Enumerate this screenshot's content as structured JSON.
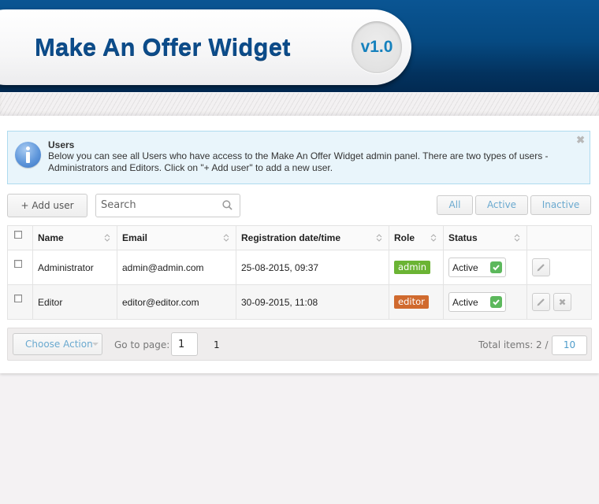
{
  "header": {
    "title": "Make An Offer Widget",
    "version": "v1.0"
  },
  "alert": {
    "icon": "info-icon",
    "title": "Users",
    "text": "Below you can see all Users who have access to the Make An Offer Widget admin panel. There are two types of users - Administrators and Editors. Click on \"+ Add user\" to add a new user.",
    "close_icon": "close-icon"
  },
  "toolbar": {
    "add_user_label": "+ Add user",
    "search_placeholder": "Search",
    "search_value": "",
    "filters": [
      "All",
      "Active",
      "Inactive"
    ]
  },
  "table": {
    "columns": [
      "Name",
      "Email",
      "Registration date/time",
      "Role",
      "Status"
    ],
    "rows": [
      {
        "name": "Administrator",
        "email": "admin@admin.com",
        "registered": "25-08-2015, 09:37",
        "role": "admin",
        "role_color": "#6bb434",
        "status": "Active",
        "actions": [
          "edit"
        ]
      },
      {
        "name": "Editor",
        "email": "editor@editor.com",
        "registered": "30-09-2015, 11:08",
        "role": "editor",
        "role_color": "#d06a2e",
        "status": "Active",
        "actions": [
          "edit",
          "delete"
        ]
      }
    ]
  },
  "footer": {
    "choose_action_label": "Choose Action",
    "goto_label": "Go to page:",
    "goto_value": "1",
    "page_link": "1",
    "total_label": "Total items: 2 /",
    "per_page": "10"
  },
  "colors": {
    "header_blue": "#064a82",
    "accent_link": "#6aa9cf",
    "status_green": "#5cb85c",
    "admin_badge": "#6bb434",
    "editor_badge": "#d06a2e"
  }
}
